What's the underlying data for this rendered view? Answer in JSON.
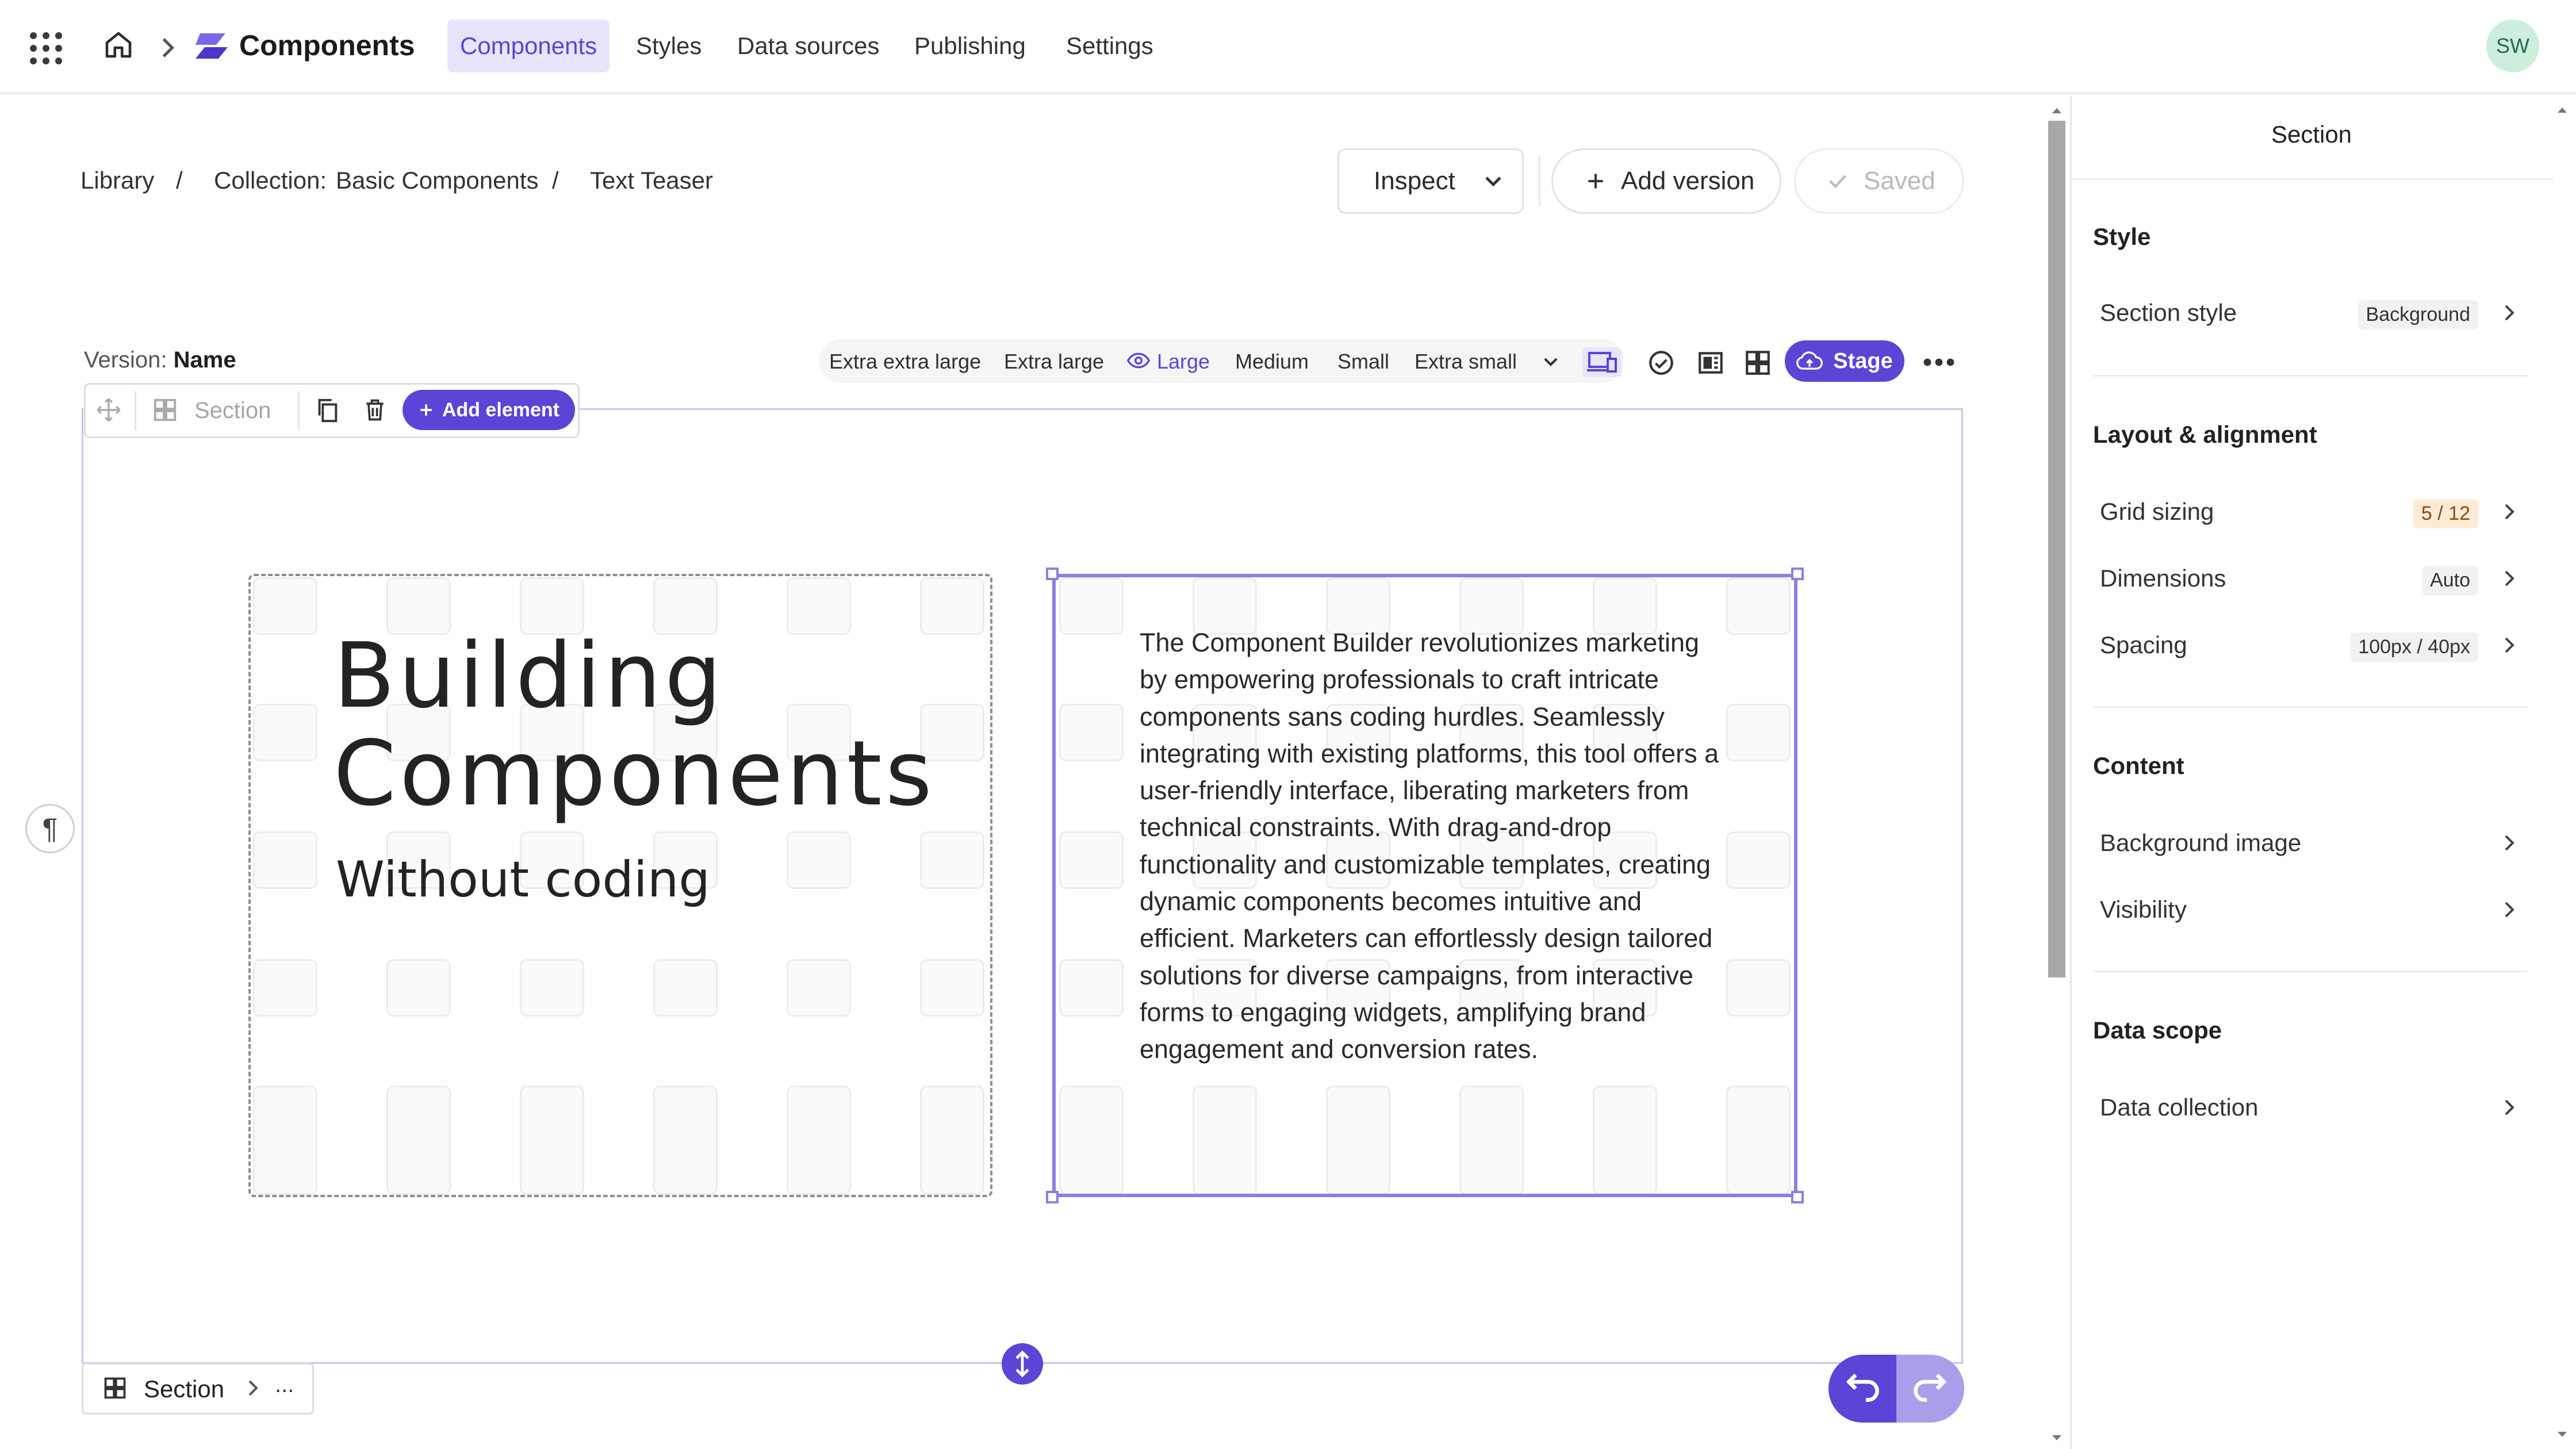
{
  "topbar": {
    "app_name": "Components",
    "tabs": [
      {
        "label": "Components",
        "active": true
      },
      {
        "label": "Styles"
      },
      {
        "label": "Data sources"
      },
      {
        "label": "Publishing"
      },
      {
        "label": "Settings"
      }
    ],
    "avatar_initials": "SW",
    "icons": [
      "apps-grid-icon",
      "home-icon",
      "chevron-right-icon",
      "components-logo-icon"
    ]
  },
  "breadcrumb": {
    "items": [
      "Library",
      "Collection:",
      "Basic Components",
      "Text Teaser"
    ],
    "separator": "/"
  },
  "actions": {
    "inspect_label": "Inspect",
    "add_version_label": "Add version",
    "saved_label": "Saved"
  },
  "version": {
    "prefix": "Version:",
    "name": "Name"
  },
  "breakpoints": {
    "items": [
      "Extra extra large",
      "Extra large",
      "Large",
      "Medium",
      "Small",
      "Extra small"
    ],
    "active": "Large"
  },
  "stage_label": "Stage",
  "section_toolbar": {
    "label": "Section",
    "add_element_label": "Add element"
  },
  "content": {
    "heading_line1": "Building",
    "heading_line2": "Components",
    "subheading": "Without coding",
    "paragraph": "The Component Builder revolutionizes marketing by empowering professionals to craft intricate components sans coding hurdles. Seamlessly integrating with existing platforms, this tool offers a user-friendly interface, liberating marketers from technical constraints. With drag-and-drop functionality and customizable templates, creating dynamic components becomes intuitive and efficient. Marketers can effortlessly design tailored solutions for diverse campaigns, from interactive forms to engaging widgets, amplifying brand engagement and conversion rates."
  },
  "footer_breadcrumb": {
    "label": "Section",
    "more": "..."
  },
  "panel": {
    "title": "Section",
    "sections": [
      {
        "title": "Style",
        "rows": [
          {
            "label": "Section style",
            "badge": "Background"
          }
        ]
      },
      {
        "title": "Layout & alignment",
        "rows": [
          {
            "label": "Grid sizing",
            "badge": "5 / 12"
          },
          {
            "label": "Dimensions",
            "badge": "Auto"
          },
          {
            "label": "Spacing",
            "badge": "100px / 40px"
          }
        ]
      },
      {
        "title": "Content",
        "rows": [
          {
            "label": "Background image"
          },
          {
            "label": "Visibility"
          }
        ]
      },
      {
        "title": "Data scope",
        "rows": [
          {
            "label": "Data collection"
          }
        ]
      }
    ]
  },
  "colors": {
    "accent": "#5a45d6",
    "accent_light": "#e8e4fb",
    "selection_border": "#8c7fe0",
    "grid_sizing_badge": "#fdebd6"
  }
}
